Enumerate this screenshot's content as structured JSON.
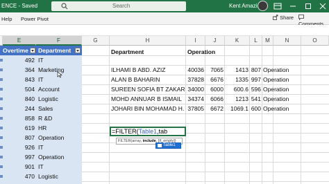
{
  "titlebar": {
    "document": "ENCE  -  Saved",
    "search_placeholder": "Search",
    "user": "Kent Amazing"
  },
  "ribbon": {
    "tabs": [
      "Help",
      "Power Pivot"
    ],
    "share": "Share",
    "comments": "Comments"
  },
  "columns": [
    "E",
    "F",
    "G",
    "H",
    "I",
    "J",
    "K",
    "L",
    "M",
    "N",
    "O"
  ],
  "table": {
    "headers": [
      "Overtime",
      "Department"
    ],
    "rows": [
      {
        "overtime": "492",
        "department": "IT"
      },
      {
        "overtime": "364",
        "department": "Marketing"
      },
      {
        "overtime": "843",
        "department": "IT"
      },
      {
        "overtime": "504",
        "department": "Account"
      },
      {
        "overtime": "840",
        "department": "Logistic"
      },
      {
        "overtime": "244",
        "department": "Sales"
      },
      {
        "overtime": "858",
        "department": "R &D"
      },
      {
        "overtime": "619",
        "department": "HR"
      },
      {
        "overtime": "807",
        "department": "Operation"
      },
      {
        "overtime": "926",
        "department": "IT"
      },
      {
        "overtime": "997",
        "department": "Operation"
      },
      {
        "overtime": "901",
        "department": "IT"
      },
      {
        "overtime": "470",
        "department": "Logistic"
      },
      {
        "overtime": "548",
        "department": "R &D"
      }
    ]
  },
  "filter_result": {
    "header_department": "Department",
    "header_operation": "Operation",
    "rows": [
      {
        "name": "ILHAMI B ABD. AZIZ",
        "i": "40036",
        "j": "7065",
        "k": "1413",
        "l": "807",
        "dept": "Operation"
      },
      {
        "name": "ALAN B BAHARIN",
        "i": "37828",
        "j": "6676",
        "k": "1335",
        "l": "997",
        "dept": "Operation"
      },
      {
        "name": "SUREEN SOFIA BT ZAKARIA",
        "i": "34000",
        "j": "6000",
        "k": "600.6",
        "l": "596",
        "dept": "Operation"
      },
      {
        "name": "MOHD ANNUAR B ISMAIL",
        "i": "34374",
        "j": "6066",
        "k": "1213",
        "l": "541",
        "dept": "Operation"
      },
      {
        "name": "JOHARI BIN MOHAMAD H.",
        "i": "37805",
        "j": "6672",
        "k": "1069.1",
        "l": "600",
        "dept": "Operation"
      }
    ]
  },
  "formula": {
    "prefix": "=FILTER(",
    "ref": "Table1",
    "suffix": ",tab"
  },
  "tooltip": {
    "text_before": "FILTER(array, ",
    "bold": "include",
    "text_after": ", [if_empty])"
  },
  "autocomplete": {
    "item": "Table1"
  },
  "colors": {
    "excel_green": "#217346",
    "table_header": "#4472c4",
    "table_band": "#d9e5f3"
  }
}
